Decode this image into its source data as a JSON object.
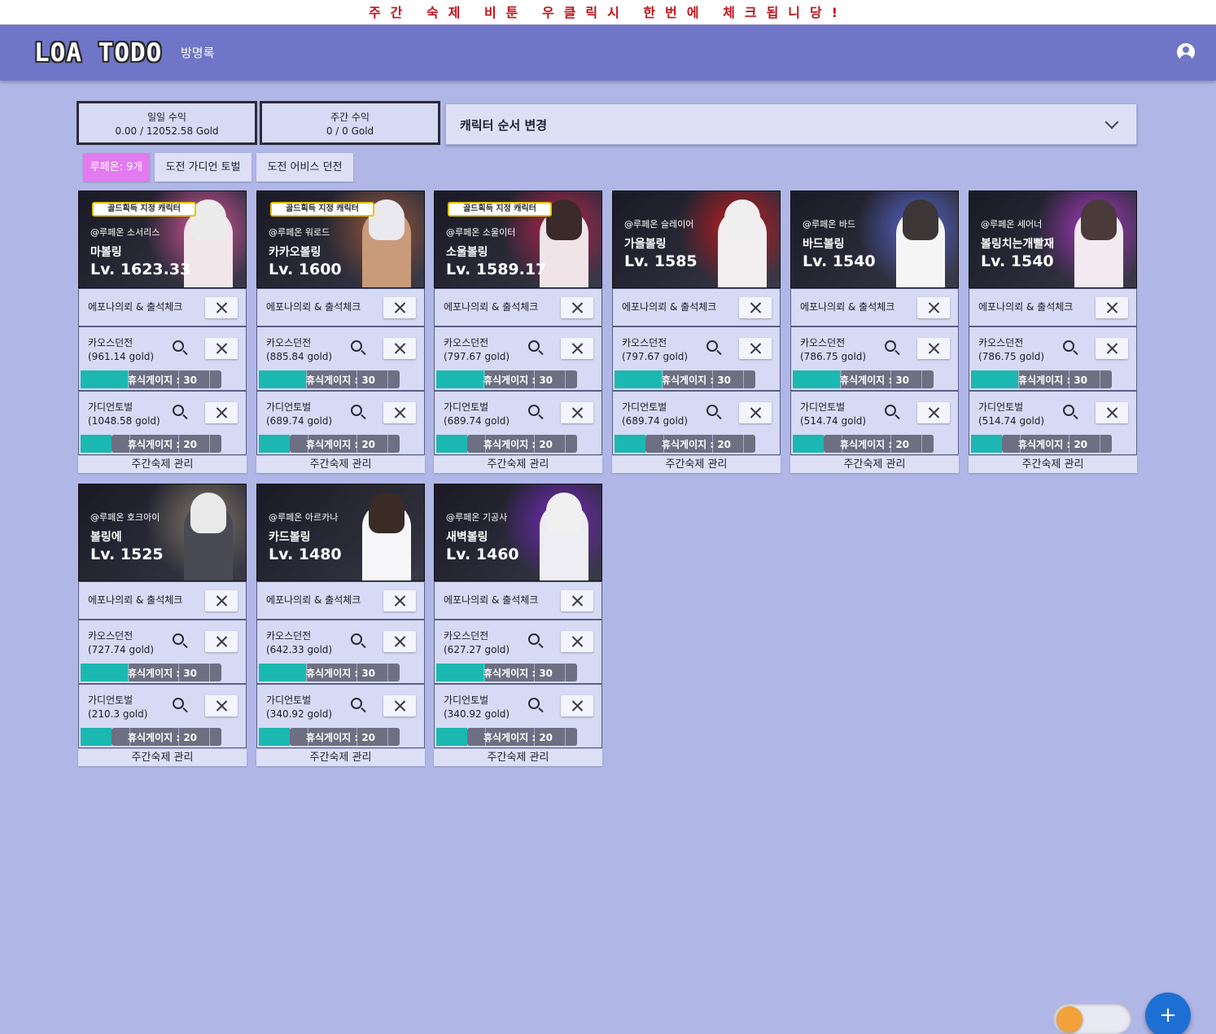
{
  "notice": "주간 숙제 비툰 우클릭시 한번에 체크됩니당!",
  "header": {
    "logo": "LOA TODO",
    "guestbook": "방명록",
    "account_icon": "account-circle-icon"
  },
  "income": {
    "daily_label": "일일 수익",
    "daily_value": "0.00 / 12052.58 Gold",
    "weekly_label": "주간 수익",
    "weekly_value": "0 / 0 Gold"
  },
  "order_select": {
    "label": "캐릭터 순서 변경",
    "icon": "chevron-down-icon"
  },
  "chips": {
    "count": "루페온: 9개",
    "guardian": "도전 가디언 토벌",
    "abyss": "도전 어비스 던전"
  },
  "labels": {
    "epona": "에포나의뢰 & 출석체크",
    "chaos": "카오스던전",
    "guardian": "가디언토벌",
    "weekly_manage": "주간숙제 관리"
  },
  "colors": {
    "accent": "#6f75c7",
    "background": "#b0b6e6",
    "gauge": "#1bb8b1",
    "chip": "#e37bf0",
    "fab": "#1e6fd4"
  },
  "characters": [
    {
      "badge": "골드획득 지정 캐릭터",
      "server": "@루페온 소서리스",
      "name": "마볼링",
      "level": "Lv. 1623.33",
      "chaos_gold": "(961.14 gold)",
      "chaos_rest": "휴식게이지 : 30",
      "guardian_gold": "(1048.58 gold)",
      "guardian_rest": "휴식게이지 : 20"
    },
    {
      "badge": "골드획득 지정 캐릭터",
      "server": "@루페온 워로드",
      "name": "카카오볼링",
      "level": "Lv. 1600",
      "chaos_gold": "(885.84 gold)",
      "chaos_rest": "휴식게이지 : 30",
      "guardian_gold": "(689.74 gold)",
      "guardian_rest": "휴식게이지 : 20"
    },
    {
      "badge": "골드획득 지정 캐릭터",
      "server": "@루페온 소울이터",
      "name": "소울볼링",
      "level": "Lv. 1589.17",
      "chaos_gold": "(797.67 gold)",
      "chaos_rest": "휴식게이지 : 30",
      "guardian_gold": "(689.74 gold)",
      "guardian_rest": "휴식게이지 : 20"
    },
    {
      "badge": "",
      "server": "@루페온 슬레이어",
      "name": "가을볼링",
      "level": "Lv. 1585",
      "chaos_gold": "(797.67 gold)",
      "chaos_rest": "휴식게이지 : 30",
      "guardian_gold": "(689.74 gold)",
      "guardian_rest": "휴식게이지 : 20"
    },
    {
      "badge": "",
      "server": "@루페온 바드",
      "name": "바드볼링",
      "level": "Lv. 1540",
      "chaos_gold": "(786.75 gold)",
      "chaos_rest": "휴식게이지 : 30",
      "guardian_gold": "(514.74 gold)",
      "guardian_rest": "휴식게이지 : 20"
    },
    {
      "badge": "",
      "server": "@루페온 세어너",
      "name": "볼링치는개빨재",
      "level": "Lv. 1540",
      "chaos_gold": "(786.75 gold)",
      "chaos_rest": "휴식게이지 : 30",
      "guardian_gold": "(514.74 gold)",
      "guardian_rest": "휴식게이지 : 20"
    },
    {
      "badge": "",
      "server": "@루페온 호크아이",
      "name": "볼링에",
      "level": "Lv. 1525",
      "chaos_gold": "(727.74 gold)",
      "chaos_rest": "휴식게이지 : 30",
      "guardian_gold": "(210.3 gold)",
      "guardian_rest": "휴식게이지 : 20"
    },
    {
      "badge": "",
      "server": "@루페온 아르카나",
      "name": "카드볼링",
      "level": "Lv. 1480",
      "chaos_gold": "(642.33 gold)",
      "chaos_rest": "휴식게이지 : 30",
      "guardian_gold": "(340.92 gold)",
      "guardian_rest": "휴식게이지 : 20"
    },
    {
      "badge": "",
      "server": "@루페온 기공사",
      "name": "새벽볼링",
      "level": "Lv. 1460",
      "chaos_gold": "(627.27 gold)",
      "chaos_rest": "휴식게이지 : 30",
      "guardian_gold": "(340.92 gold)",
      "guardian_rest": "휴식게이지 : 20"
    }
  ],
  "fab": {
    "label": "+",
    "icon": "plus-icon"
  },
  "theme_toggle": {
    "icon": "theme-toggle-knob"
  }
}
